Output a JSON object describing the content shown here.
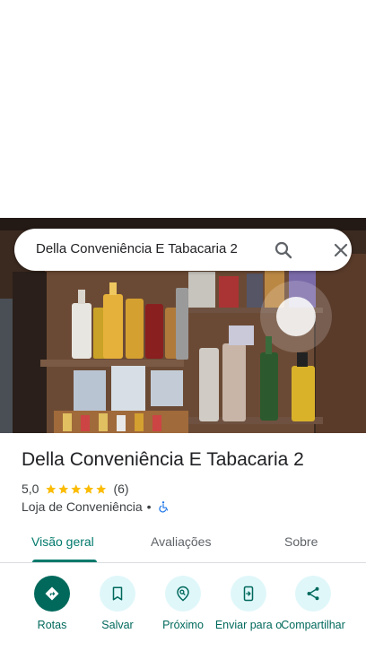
{
  "search": {
    "query": "Della Conveniência E Tabacaria 2"
  },
  "place": {
    "name": "Della Conveniência E Tabacaria 2",
    "rating": "5,0",
    "stars": 5,
    "review_count": "(6)",
    "category": "Loja de Conveniência",
    "separator": "•"
  },
  "tabs": [
    {
      "label": "Visão geral",
      "active": true
    },
    {
      "label": "Avaliações",
      "active": false
    },
    {
      "label": "Sobre",
      "active": false
    }
  ],
  "actions": [
    {
      "label": "Rotas",
      "icon": "directions-icon"
    },
    {
      "label": "Salvar",
      "icon": "bookmark-icon"
    },
    {
      "label": "Próximo",
      "icon": "nearby-icon"
    },
    {
      "label": "Enviar para o",
      "icon": "send-to-phone-icon"
    },
    {
      "label": "Compartilhar",
      "icon": "share-icon"
    }
  ],
  "colors": {
    "accent": "#00796b",
    "action_bg": "#e0f7fa",
    "primary_action": "#00695c",
    "star": "#fbbc04"
  }
}
